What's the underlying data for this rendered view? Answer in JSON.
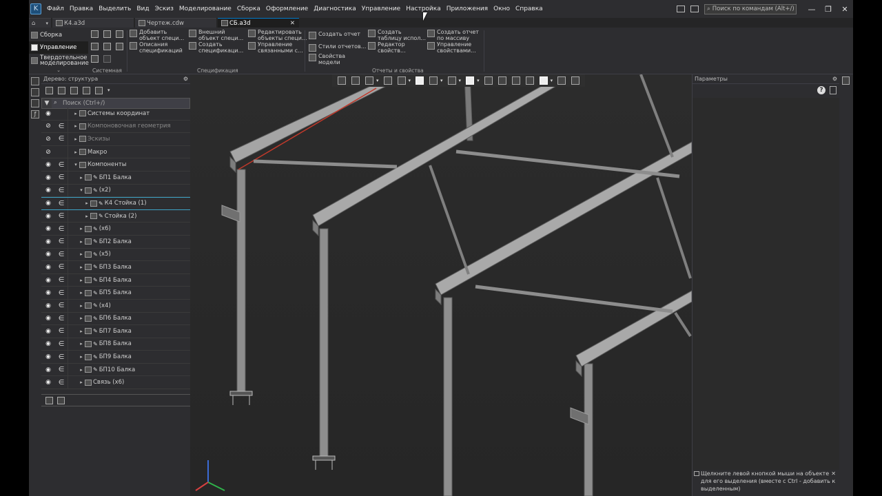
{
  "menubar": {
    "logo": "K",
    "items": [
      "Файл",
      "Правка",
      "Выделить",
      "Вид",
      "Эскиз",
      "Моделирование",
      "Сборка",
      "Оформление",
      "Диагностика",
      "Управление",
      "Настройка",
      "Приложения",
      "Окно",
      "Справка"
    ],
    "search_placeholder": "Поиск по командам (Alt+/)",
    "minimize": "—",
    "restore": "❐",
    "close": "✕"
  },
  "tabs": [
    {
      "label": "К4.a3d",
      "active": false
    },
    {
      "label": "Чертеж.cdw",
      "active": false
    },
    {
      "label": "СБ.a3d",
      "active": true
    }
  ],
  "ribbon": {
    "side": [
      "Сборка",
      "Управление",
      "Твердотельное моделирование"
    ],
    "groups": [
      "Системная",
      "Спецификация",
      "Отчеты и свойства"
    ],
    "buttons": {
      "add_spec": "Добавить\nобъект специ...",
      "ext_spec": "Внешний\nобъект специ...",
      "edit_spec": "Редактировать\nобъекты специ...",
      "desc_spec": "Описания\nспецификаций",
      "create_spec": "Создать\nспецификаци...",
      "manage_linked": "Управление\nсвязанными с...",
      "create_report": "Создать отчет",
      "create_table": "Создать\nтаблицу испол...",
      "create_report_mass": "Создать отчет\nпо массиву",
      "report_styles": "Стили отчетов...",
      "prop_editor": "Редактор\nсвойств...",
      "manage_props": "Управление\nсвойствами...",
      "model_props": "Свойства\nмодели"
    }
  },
  "tree": {
    "title": "Дерево: структура",
    "search_placeholder": "Поиск (Ctrl+/)",
    "rows": [
      {
        "label": "Системы координат",
        "indent": 1,
        "eye": true,
        "include": false,
        "pin": false,
        "dim": false,
        "sel": false
      },
      {
        "label": "Компоновочная геометрия",
        "indent": 1,
        "eye": false,
        "include": true,
        "pin": false,
        "dim": true,
        "sel": false
      },
      {
        "label": "Эскизы",
        "indent": 1,
        "eye": false,
        "include": true,
        "pin": false,
        "dim": true,
        "sel": false
      },
      {
        "label": "Макро",
        "indent": 1,
        "eye": false,
        "include": false,
        "pin": false,
        "dim": false,
        "sel": false
      },
      {
        "label": "Компоненты",
        "indent": 1,
        "eye": true,
        "include": true,
        "pin": false,
        "dim": false,
        "sel": false
      },
      {
        "label": "БП1 Балка",
        "indent": 2,
        "eye": true,
        "include": true,
        "pin": true,
        "dim": false,
        "sel": false
      },
      {
        "label": "(x2)",
        "indent": 2,
        "eye": true,
        "include": true,
        "pin": true,
        "dim": false,
        "sel": false
      },
      {
        "label": "К4 Стойка (1)",
        "indent": 3,
        "eye": true,
        "include": true,
        "pin": true,
        "dim": false,
        "sel": true
      },
      {
        "label": "Стойка (2)",
        "indent": 3,
        "eye": true,
        "include": true,
        "pin": true,
        "dim": false,
        "sel": false
      },
      {
        "label": "(x6)",
        "indent": 2,
        "eye": true,
        "include": true,
        "pin": true,
        "dim": false,
        "sel": false
      },
      {
        "label": "БП2 Балка",
        "indent": 2,
        "eye": true,
        "include": true,
        "pin": true,
        "dim": false,
        "sel": false
      },
      {
        "label": "(x5)",
        "indent": 2,
        "eye": true,
        "include": true,
        "pin": true,
        "dim": false,
        "sel": false
      },
      {
        "label": "БП3 Балка",
        "indent": 2,
        "eye": true,
        "include": true,
        "pin": true,
        "dim": false,
        "sel": false
      },
      {
        "label": "БП4 Балка",
        "indent": 2,
        "eye": true,
        "include": true,
        "pin": true,
        "dim": false,
        "sel": false
      },
      {
        "label": "БП5 Балка",
        "indent": 2,
        "eye": true,
        "include": true,
        "pin": true,
        "dim": false,
        "sel": false
      },
      {
        "label": "(x4)",
        "indent": 2,
        "eye": true,
        "include": true,
        "pin": true,
        "dim": false,
        "sel": false
      },
      {
        "label": "БП6 Балка",
        "indent": 2,
        "eye": true,
        "include": true,
        "pin": true,
        "dim": false,
        "sel": false
      },
      {
        "label": "БП7 Балка",
        "indent": 2,
        "eye": true,
        "include": true,
        "pin": true,
        "dim": false,
        "sel": false
      },
      {
        "label": "БП8 Балка",
        "indent": 2,
        "eye": true,
        "include": true,
        "pin": true,
        "dim": false,
        "sel": false
      },
      {
        "label": "БП9 Балка",
        "indent": 2,
        "eye": true,
        "include": true,
        "pin": true,
        "dim": false,
        "sel": false
      },
      {
        "label": "БП10 Балка",
        "indent": 2,
        "eye": true,
        "include": true,
        "pin": true,
        "dim": false,
        "sel": false
      },
      {
        "label": "Связь (x6)",
        "indent": 2,
        "eye": true,
        "include": true,
        "pin": false,
        "dim": false,
        "sel": false
      }
    ]
  },
  "params": {
    "title": "Параметры",
    "hint": "Щелкните левой кнопкой мыши на объекте для его выделения (вместе с Ctrl - добавить к выделенным)",
    "close": "✕"
  },
  "colors": {
    "background": "#2b2b2b",
    "accent": "#3ea3c7",
    "steel": "#9a9a9a",
    "selection_red": "#c0392b"
  }
}
